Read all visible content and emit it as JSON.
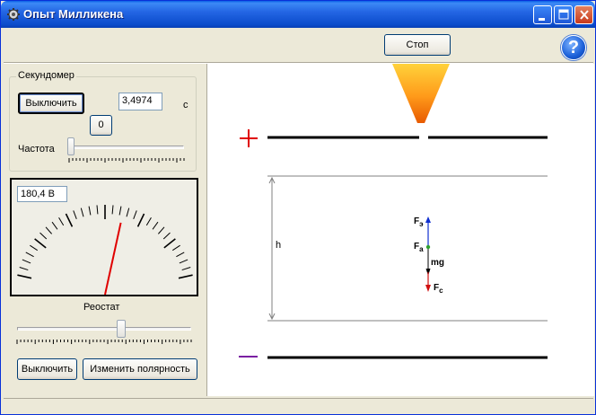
{
  "window": {
    "title": "Опыт Милликена"
  },
  "toolbar": {
    "stop_label": "Стоп",
    "help_label": "?"
  },
  "stopwatch": {
    "legend": "Секундомер",
    "toggle_label": "Выключить",
    "time_value": "3,4974",
    "unit": "с",
    "reset_label": "0",
    "frequency_label": "Частота"
  },
  "meter": {
    "voltage_value": "180,4  В",
    "needle_fraction": 0.58
  },
  "rheostat": {
    "label": "Реостат",
    "slider_fraction": 0.6
  },
  "bottom_buttons": {
    "off_label": "Выключить",
    "polarity_label": "Изменить полярность"
  },
  "experiment": {
    "plus_sign": "+",
    "minus_sign": "—",
    "height_label": "h",
    "force_e_main": "F",
    "force_e_sub": "э",
    "force_a_main": "F",
    "force_a_sub": "a",
    "gravity_label": "mg",
    "force_c_main": "F",
    "force_c_sub": "c",
    "colors": {
      "plus": "#e00000",
      "minus": "#7a1fa2",
      "electric_force": "#1030d0",
      "resistance_force": "#d01010",
      "droplet": "#30a030"
    }
  }
}
